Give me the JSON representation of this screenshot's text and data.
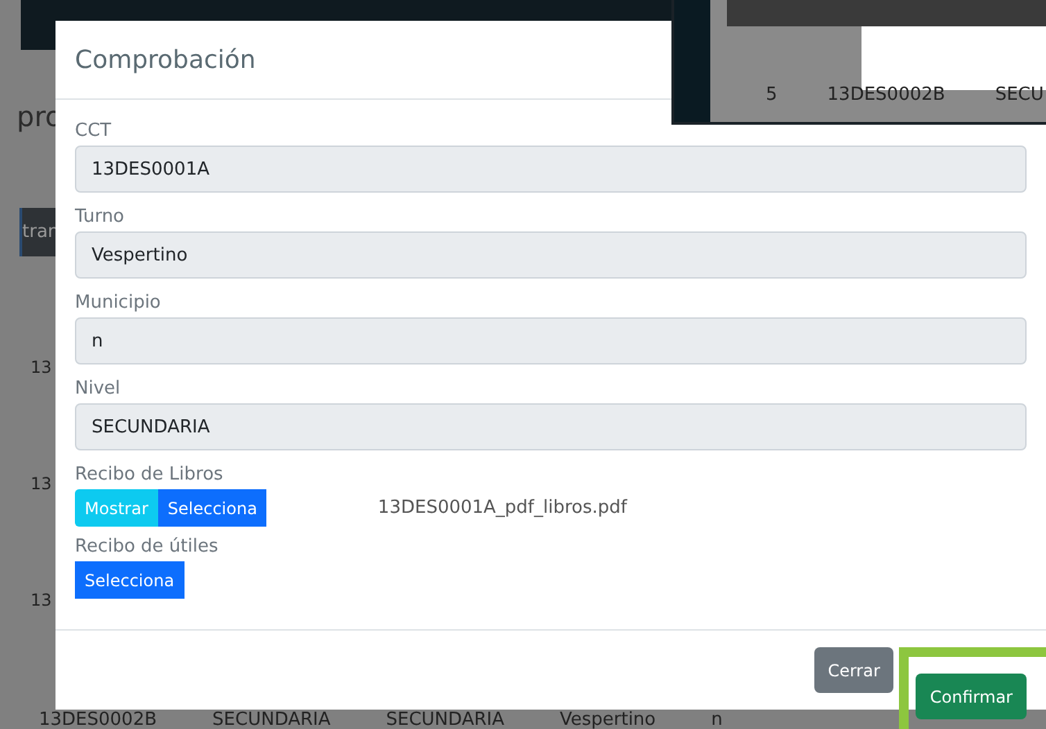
{
  "background": {
    "heading_fragment": "pro",
    "column_fragment": "tran",
    "row_cells": [
      "13",
      "13",
      "13"
    ],
    "bottom_row": [
      "13DES0002B",
      "SECUNDARIA",
      "SECUNDARIA",
      "Vespertino",
      "n"
    ]
  },
  "overlay_panel": {
    "row": [
      "5",
      "13DES0002B",
      "SECU"
    ]
  },
  "modal": {
    "title": "Comprobación",
    "fields": [
      {
        "label": "CCT",
        "value": "13DES0001A"
      },
      {
        "label": "Turno",
        "value": "Vespertino"
      },
      {
        "label": "Municipio",
        "value": "n"
      },
      {
        "label": "Nivel",
        "value": "SECUNDARIA"
      }
    ],
    "uploads": [
      {
        "label": "Recibo de Libros",
        "buttons": [
          {
            "label": "Mostrar",
            "kind": "show"
          },
          {
            "label": "Selecciona",
            "kind": "select"
          }
        ],
        "file_name": "13DES0001A_pdf_libros.pdf"
      },
      {
        "label": "Recibo de útiles",
        "buttons": [
          {
            "label": "Selecciona",
            "kind": "select"
          }
        ]
      }
    ],
    "buttons": [
      {
        "label": "Cerrar",
        "kind": "secondary",
        "highlighted": false
      },
      {
        "label": "Confirmar",
        "kind": "primary",
        "highlighted": true
      }
    ]
  }
}
